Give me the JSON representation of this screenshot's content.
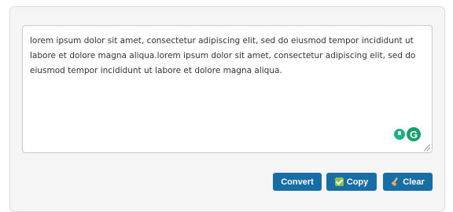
{
  "editor": {
    "text": "lorem ipsum dolor sit amet, consectetur adipiscing elit, sed do eiusmod tempor incididunt ut labore et dolore magna aliqua.lorem ipsum dolor sit amet, consectetur adipiscing elit, sed do eiusmod tempor incididunt ut labore et dolore magna aliqua."
  },
  "grammarly": {
    "letter": "G"
  },
  "actions": {
    "convert_label": "Convert",
    "copy_label": "Copy",
    "clear_label": "Clear"
  },
  "icons": {
    "copy": "checkbox-icon",
    "clear": "broom-icon",
    "assist": "lightbulb-icon",
    "grammarly": "grammarly-icon"
  },
  "colors": {
    "button": "#176da6",
    "grammarly": "#15a06c"
  }
}
